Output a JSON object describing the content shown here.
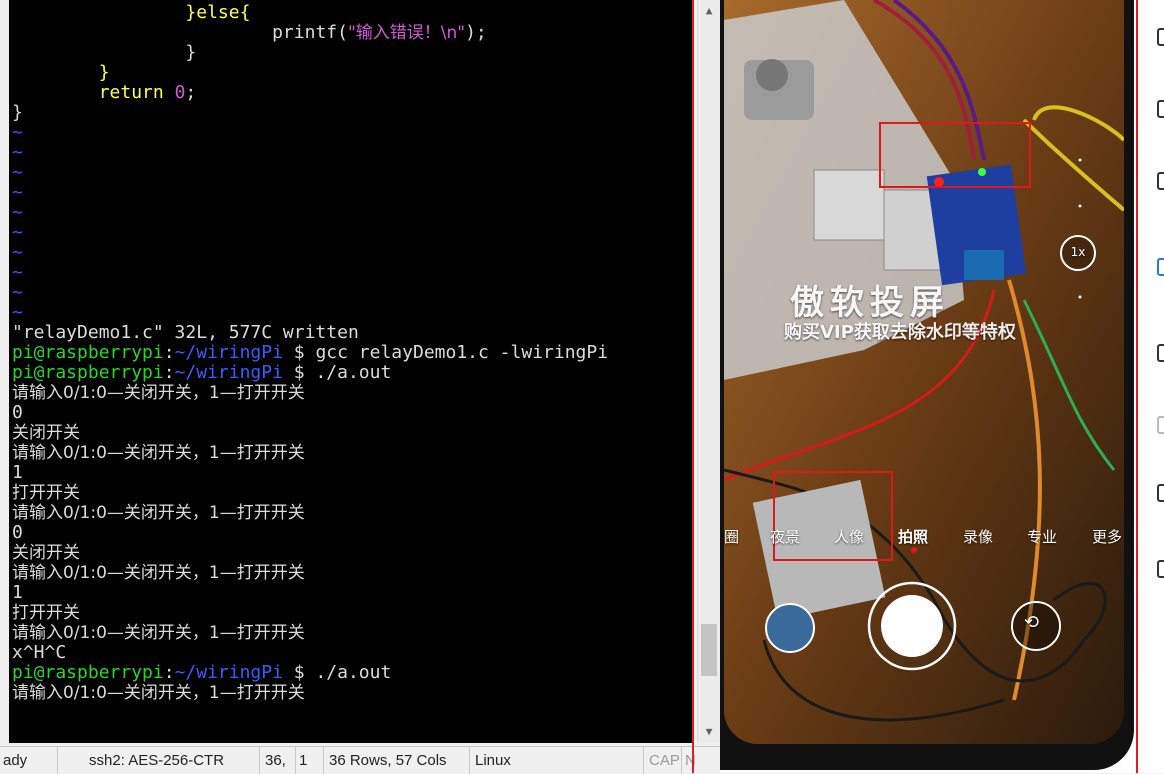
{
  "terminal": {
    "code_lines": [
      {
        "indent": "                ",
        "keyword": "}else{"
      },
      {
        "indent": "                        ",
        "fn": "printf(",
        "str": "\"输入错误！\\n\"",
        "tail": ");"
      },
      {
        "indent": "                ",
        "keyword": "}"
      },
      {
        "indent": "        ",
        "keyword": "}"
      },
      {
        "indent": "        ",
        "kw_return": "return",
        "num": "0",
        "tail": ";"
      },
      {
        "indent": "",
        "keyword": "}"
      }
    ],
    "tilde": "~",
    "tilde_count": 10,
    "written_msg": "\"relayDemo1.c\" 32L, 577C written",
    "prompt_user": "pi@raspberrypi",
    "prompt_colon": ":",
    "prompt_path": "~/wiringPi",
    "prompt_dollar": " $ ",
    "cmd_gcc": "gcc relayDemo1.c -lwiringPi",
    "cmd_run": "./a.out",
    "ask": "请输入0/1:0—关闭开关，1—打开开关",
    "input_0": "0",
    "input_1": "1",
    "msg_off": "关闭开关",
    "msg_on": "打开开关",
    "interrupt": "x^H^C"
  },
  "statusbar": {
    "ready": "ady",
    "cipher": "ssh2: AES-256-CTR",
    "cursor_row": "36,",
    "cursor_col": "1",
    "size": "36 Rows, 57 Cols",
    "os": "Linux",
    "cap": "CAP",
    "num": "N"
  },
  "scrollbar": {
    "up": "▲",
    "down": "▼",
    "position": 0.93
  },
  "camera": {
    "watermark_title": "傲软投屏",
    "watermark_sub": "购买VIP获取去除水印等特权",
    "zoom": "1x",
    "modes": [
      "圈",
      "夜景",
      "人像",
      "拍照",
      "录像",
      "专业",
      "更多"
    ],
    "active_mode": "拍照"
  }
}
